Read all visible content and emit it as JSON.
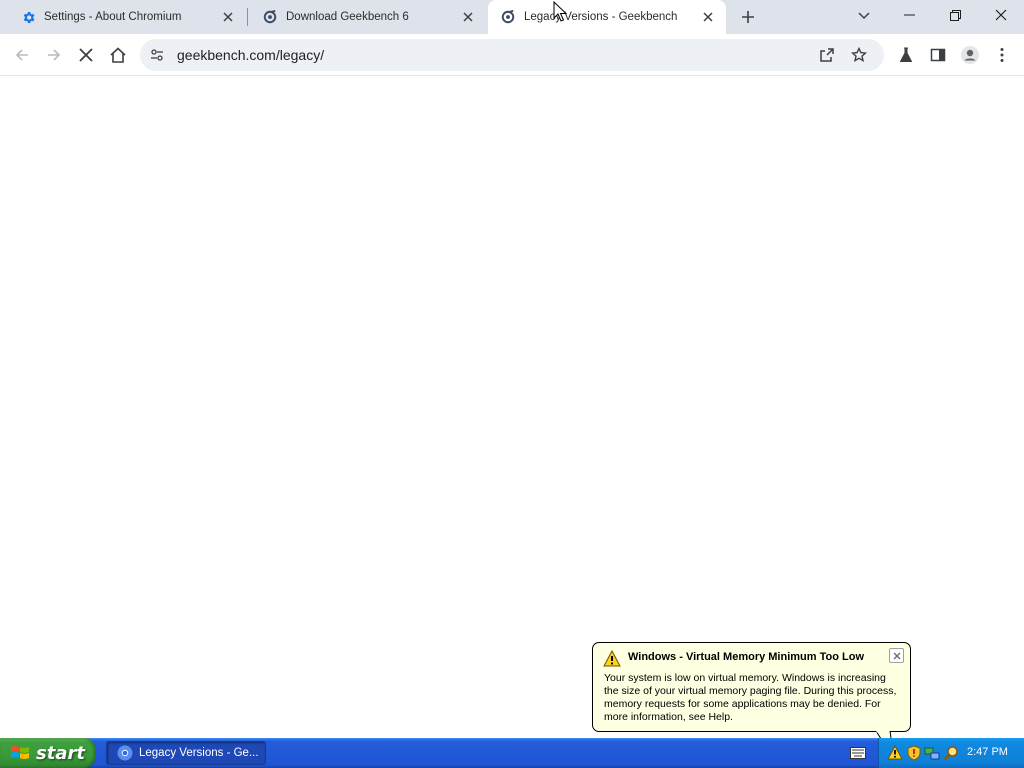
{
  "browser": {
    "tabs": [
      {
        "title": "Settings - About Chromium",
        "icon": "gear-icon",
        "active": false
      },
      {
        "title": "Download Geekbench 6",
        "icon": "geekbench-icon",
        "active": false
      },
      {
        "title": "Legacy Versions - Geekbench",
        "icon": "geekbench-icon",
        "active": true
      }
    ],
    "address_bar": {
      "url": "geekbench.com/legacy/"
    },
    "loading": true
  },
  "notification": {
    "title": "Windows - Virtual Memory Minimum Too Low",
    "body": "Your system is low on virtual memory. Windows is increasing the size of your virtual memory paging file. During this process, memory requests for some applications may be denied. For more information, see Help.",
    "icon": "warning-icon"
  },
  "taskbar": {
    "start_label": "start",
    "items": [
      {
        "label": "Legacy Versions - Ge...",
        "icon": "chromium-icon"
      }
    ],
    "tray_icons": [
      "warning-icon",
      "security-shield-icon",
      "network-icon",
      "search-icon"
    ],
    "clock": "2:47 PM"
  },
  "colors": {
    "tabstrip_bg": "#dee3eb",
    "omnibox_bg": "#edf0f5",
    "gear_blue": "#1a73e8",
    "taskbar_blue": "#245edc",
    "start_green": "#3c9f3c",
    "balloon_bg": "#ffffe1"
  }
}
